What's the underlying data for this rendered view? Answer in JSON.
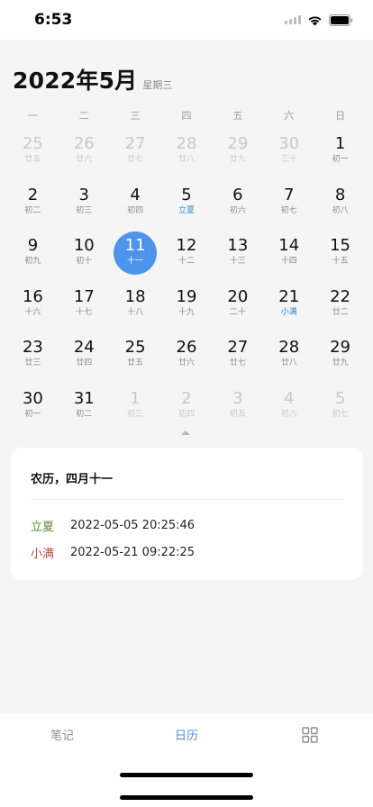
{
  "status": {
    "time": "6:53"
  },
  "header": {
    "title": "2022年5月",
    "weekday": "星期三"
  },
  "week_days": [
    "一",
    "二",
    "三",
    "四",
    "五",
    "六",
    "日"
  ],
  "calendar": {
    "days": [
      {
        "day": "25",
        "lunar": "廿五",
        "type": "other"
      },
      {
        "day": "26",
        "lunar": "廿六",
        "type": "other"
      },
      {
        "day": "27",
        "lunar": "廿七",
        "type": "other"
      },
      {
        "day": "28",
        "lunar": "廿八",
        "type": "other"
      },
      {
        "day": "29",
        "lunar": "廿九",
        "type": "other"
      },
      {
        "day": "30",
        "lunar": "三十",
        "type": "other"
      },
      {
        "day": "1",
        "lunar": "初一",
        "type": "normal"
      },
      {
        "day": "2",
        "lunar": "初二",
        "type": "normal"
      },
      {
        "day": "3",
        "lunar": "初三",
        "type": "normal"
      },
      {
        "day": "4",
        "lunar": "初四",
        "type": "normal"
      },
      {
        "day": "5",
        "lunar": "立夏",
        "type": "term"
      },
      {
        "day": "6",
        "lunar": "初六",
        "type": "normal"
      },
      {
        "day": "7",
        "lunar": "初七",
        "type": "normal"
      },
      {
        "day": "8",
        "lunar": "初八",
        "type": "normal"
      },
      {
        "day": "9",
        "lunar": "初九",
        "type": "normal"
      },
      {
        "day": "10",
        "lunar": "初十",
        "type": "normal"
      },
      {
        "day": "11",
        "lunar": "十一",
        "type": "today"
      },
      {
        "day": "12",
        "lunar": "十二",
        "type": "normal"
      },
      {
        "day": "13",
        "lunar": "十三",
        "type": "normal"
      },
      {
        "day": "14",
        "lunar": "十四",
        "type": "normal"
      },
      {
        "day": "15",
        "lunar": "十五",
        "type": "normal"
      },
      {
        "day": "16",
        "lunar": "十六",
        "type": "normal"
      },
      {
        "day": "17",
        "lunar": "十七",
        "type": "normal"
      },
      {
        "day": "18",
        "lunar": "十八",
        "type": "normal"
      },
      {
        "day": "19",
        "lunar": "十九",
        "type": "normal"
      },
      {
        "day": "20",
        "lunar": "二十",
        "type": "normal"
      },
      {
        "day": "21",
        "lunar": "小满",
        "type": "term"
      },
      {
        "day": "22",
        "lunar": "廿二",
        "type": "normal"
      },
      {
        "day": "23",
        "lunar": "廿三",
        "type": "normal"
      },
      {
        "day": "24",
        "lunar": "廿四",
        "type": "normal"
      },
      {
        "day": "25",
        "lunar": "廿五",
        "type": "normal"
      },
      {
        "day": "26",
        "lunar": "廿六",
        "type": "normal"
      },
      {
        "day": "27",
        "lunar": "廿七",
        "type": "normal"
      },
      {
        "day": "28",
        "lunar": "廿八",
        "type": "normal"
      },
      {
        "day": "29",
        "lunar": "廿九",
        "type": "normal"
      },
      {
        "day": "30",
        "lunar": "初一",
        "type": "normal"
      },
      {
        "day": "31",
        "lunar": "初二",
        "type": "normal"
      },
      {
        "day": "1",
        "lunar": "初三",
        "type": "other"
      },
      {
        "day": "2",
        "lunar": "初四",
        "type": "other"
      },
      {
        "day": "3",
        "lunar": "初五",
        "type": "other"
      },
      {
        "day": "4",
        "lunar": "初六",
        "type": "other"
      },
      {
        "day": "5",
        "lunar": "初七",
        "type": "other"
      }
    ]
  },
  "detail": {
    "title": "农历，四月十一",
    "terms": [
      {
        "name": "立夏",
        "datetime": "2022-05-05 20:25:46",
        "color": "#5f8a3a"
      },
      {
        "name": "小满",
        "datetime": "2022-05-21 09:22:25",
        "color": "#b04a3c"
      }
    ]
  },
  "tabs": {
    "notes": "笔记",
    "calendar": "日历",
    "more_icon": "grid-icon"
  },
  "colors": {
    "accent": "#4d95ec",
    "term_blue": "#2f86d6"
  }
}
